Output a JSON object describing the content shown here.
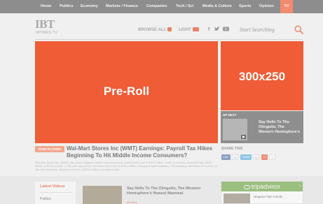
{
  "nav": {
    "items": [
      "Home",
      "Politics",
      "Economy",
      "Markets / Finance",
      "Companies",
      "Tech / Sci",
      "Media & Culture",
      "Sports",
      "Opinion",
      "TV"
    ]
  },
  "header": {
    "logo": "IBT",
    "logo_sub": "IBTIMES.TV",
    "browse_all": "BROWSE ALL",
    "light": "LIGHT",
    "social_icons": [
      "facebook-icon",
      "twitter-icon",
      "youtube-icon"
    ],
    "search_placeholder": "Start Searching"
  },
  "ads": {
    "preroll": "Pre-Roll",
    "mrec": "300x250"
  },
  "up_next": {
    "label": "UP NEXT",
    "title": "Say Hello To The Olinguito, The Western Hemisphere's"
  },
  "video": {
    "now_playing": "NOW PLAYING",
    "headline": "Wal-Mart Stores Inc (WMT) Earnings: Payroll Tax Hikes Beginning To Hit Middle Income Consumers?",
    "summary": "Wal-Mart Stores Inc. (WMT), the world's biggest retailer, reported second quarter profit rose to $4.07 billion, or $1.24 a share, compared with $3.82 billion, or $1.09 a share, in the year-ago period. Revenue rose 2.4% to $116.2 billion, missing analyst estimates. The company started $1.25 a share, in line with estimates. Revenue came in at $116.2 billion, compared with"
  },
  "share": {
    "label": "SHARE THIS",
    "buttons": [
      {
        "label": "Like",
        "count": "14"
      },
      {
        "label": "Tweet",
        "count": "45"
      },
      {
        "label": "+1",
        "count": "2"
      }
    ]
  },
  "lower": {
    "latest_videos": "Latest Videos",
    "politics": "Politics",
    "feature_title": "Say Hello To The Olinguito, The Western Hemisphere's Newest Mammal",
    "feature_tag": "IBTimes",
    "tripadvisor": "tripadvisor",
    "ta_close": "x",
    "ta_text": "Niagara Falls Family ..."
  },
  "colors": {
    "accent": "#ef5c36",
    "nav_bg": "#8d8d8d",
    "tv_tab": "#f28b6d"
  }
}
